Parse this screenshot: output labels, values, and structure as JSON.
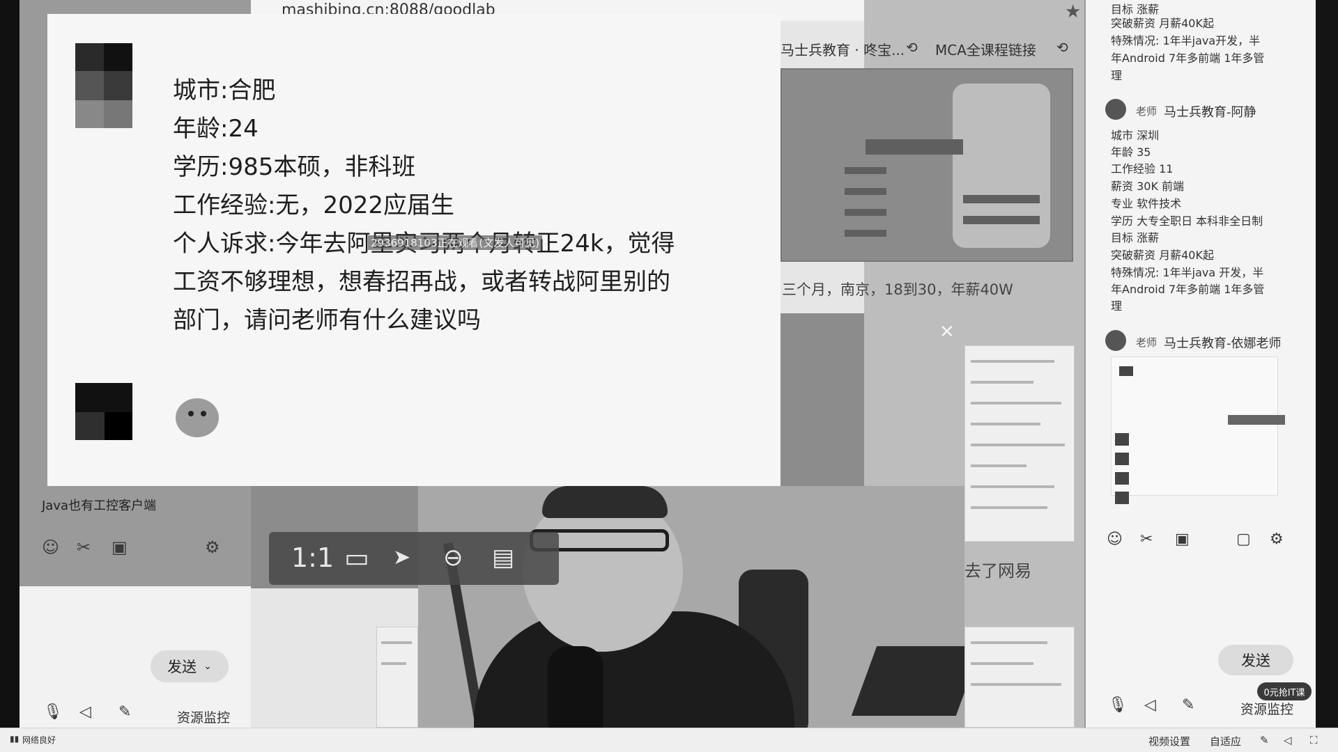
{
  "browser": {
    "url": "mashibing.cn:8088/goodlab",
    "tabs": [
      "马士兵教育 · 咚宝...",
      "MCA全课程链接"
    ]
  },
  "profile_card": {
    "lines": [
      "城市:合肥",
      "年龄:24",
      "学历:985本硕，非科班",
      "工作经验:无，2022应届生",
      "个人诉求:今年去阿里实习两个月转正24k，觉得",
      "工资不够理想，想春招再战，或者转战阿里别的",
      "部门，请问老师有什么建议吗"
    ],
    "watermark": "2936918103正在观看(文发人可见)"
  },
  "image_viewer": {
    "ratio_label": "1:1"
  },
  "background_captions": {
    "line1": "三个月，南京，18到30，年薪40W",
    "line2": "去了网易"
  },
  "left_panel": {
    "message_snippet": "Java也有工控客户端",
    "send_label": "发送",
    "resource_monitor": "资源监控"
  },
  "right_panel": {
    "top_fragment": [
      "目标 涨薪",
      "突破薪资 月薪40K起",
      "特殊情况: 1年半java开发，半",
      "年Android 7年多前端 1年多管",
      "理"
    ],
    "message1": {
      "role": "老师",
      "name": "马士兵教育-阿静",
      "lines": [
        "城市 深圳",
        "年龄 35",
        "工作经验 11",
        "薪资 30K 前端",
        "专业 软件技术",
        "学历 大专全职日 本科非全日制",
        "目标 涨薪",
        "突破薪资 月薪40K起",
        "特殊情况: 1年半java 开发，半",
        "年Android 7年多前端 1年多管",
        "理"
      ]
    },
    "message2": {
      "role": "老师",
      "name": "马士兵教育-依娜老师"
    },
    "send_label": "发送",
    "promo_badge": "0元抢IT课",
    "resource_monitor": "资源监控"
  },
  "status_bar": {
    "network": "网络良好",
    "video_settings": "视频设置",
    "adaptive": "自适应"
  }
}
